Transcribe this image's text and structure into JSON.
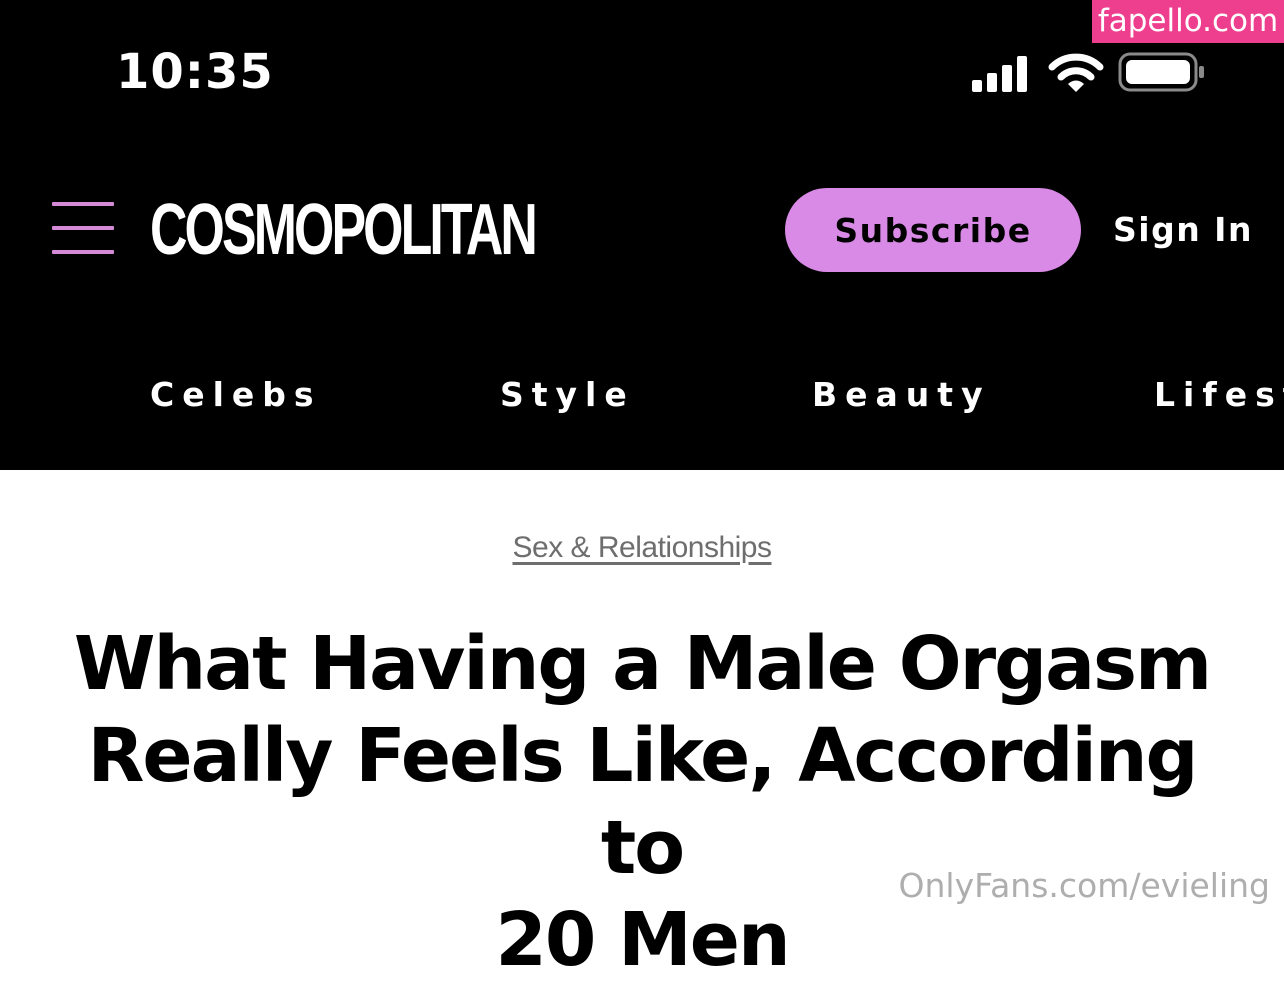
{
  "status_bar": {
    "time": "10:35",
    "icons": [
      "cellular-signal-icon",
      "wifi-icon",
      "battery-icon"
    ]
  },
  "watermarks": {
    "top_right": "fapello.com",
    "bottom_right": "OnlyFans.com/evieling"
  },
  "header": {
    "logo_text": "COSMOPOLITAN",
    "menu_icon": "hamburger-menu-icon",
    "subscribe_label": "Subscribe",
    "sign_in_label": "Sign In"
  },
  "nav": {
    "items": [
      {
        "label": "Celebs"
      },
      {
        "label": "Style"
      },
      {
        "label": "Beauty"
      },
      {
        "label": "Lifest"
      }
    ]
  },
  "article": {
    "category": "Sex & Relationships",
    "headline_lines": [
      "What Having a Male Orgasm",
      "Really Feels Like, According to",
      "20 Men"
    ]
  },
  "colors": {
    "header_bg": "#000000",
    "accent": "#d98ae6",
    "menu_icon": "#d58ad8",
    "watermark_bg": "#ee3f8e"
  }
}
